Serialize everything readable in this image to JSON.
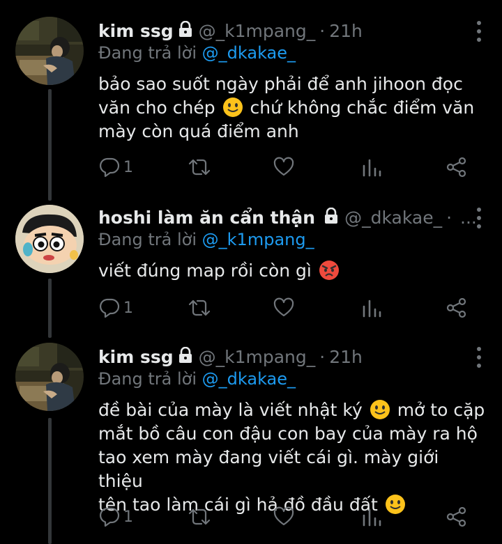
{
  "tweets": [
    {
      "name": "kim ssg",
      "handle": "@_k1mpang_",
      "dot": "·",
      "time": "21h",
      "reply_prefix": "Đang trả lời",
      "reply_to": "@_dkakae_",
      "text_lines": [
        "bảo sao suốt ngày phải để anh jihoon đọc",
        "văn cho chép",
        "chứ không chắc điểm văn",
        "mày còn quá điểm anh"
      ],
      "reply_count": "1",
      "avatar": "painting-avatar"
    },
    {
      "name": "hoshi làm ăn cẩn thận",
      "handle": "@_dkakae_",
      "dot": "·",
      "ellipsis": "...",
      "reply_prefix": "Đang trả lời",
      "reply_to": "@_k1mpang_",
      "text_lines": [
        "viết đúng map rồi còn gì"
      ],
      "reply_count": "1",
      "avatar": "cartoon-avatar"
    },
    {
      "name": "kim ssg",
      "handle": "@_k1mpang_",
      "dot": "·",
      "time": "21h",
      "reply_prefix": "Đang trả lời",
      "reply_to": "@_dkakae_",
      "text_lines": [
        "đề bài của mày là viết nhật ký",
        "mở to cặp",
        "mắt bồ câu con đậu con bay của mày ra hộ",
        "tao xem mày đang viết cái gì. mày giới thiệu",
        "tên tao làm cái gì hả đồ đầu đất"
      ],
      "reply_count": "1",
      "avatar": "painting-avatar"
    }
  ],
  "colors": {
    "background": "#000000",
    "text": "#e7e9ea",
    "muted": "#71767b",
    "mention": "#1d9bf0",
    "thread": "#333639"
  },
  "icons": [
    "lock-icon",
    "more-icon",
    "reply-icon",
    "retweet-icon",
    "like-icon",
    "views-icon",
    "share-icon",
    "slight-smile-emoji",
    "angry-emoji"
  ]
}
